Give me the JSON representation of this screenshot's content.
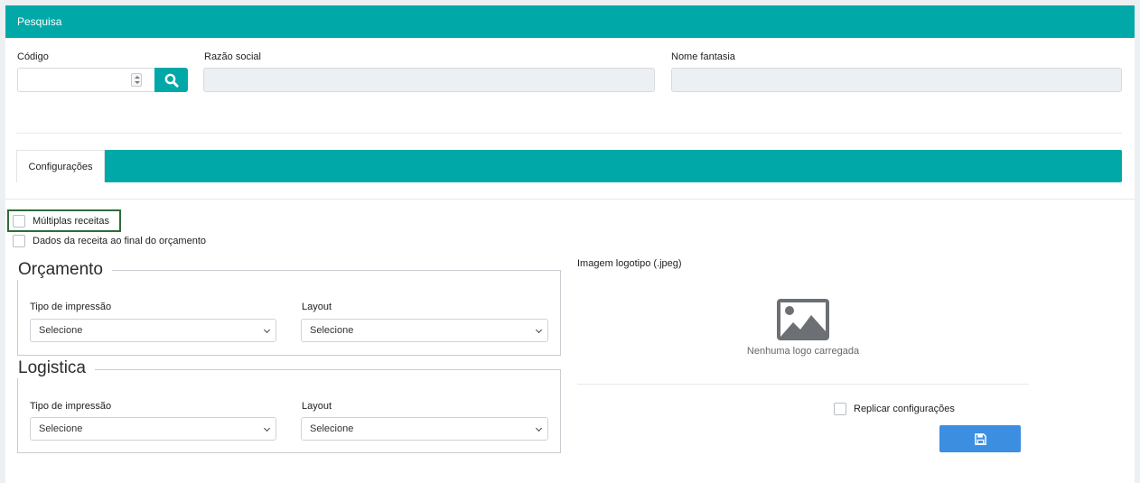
{
  "header": {
    "title": "Pesquisa"
  },
  "search": {
    "codigo_label": "Código",
    "codigo_value": "",
    "razao_label": "Razão social",
    "razao_value": "",
    "fantasia_label": "Nome fantasia",
    "fantasia_value": ""
  },
  "tabs": [
    {
      "label": "Configurações",
      "active": true
    }
  ],
  "options": {
    "multiplas_label": "Múltiplas receitas",
    "multiplas_checked": false,
    "dados_label": "Dados da receita ao final do orçamento",
    "dados_checked": false
  },
  "orcamento": {
    "title": "Orçamento",
    "tipo_label": "Tipo de impressão",
    "tipo_value": "Selecione",
    "layout_label": "Layout",
    "layout_value": "Selecione"
  },
  "logistica": {
    "title": "Logistica",
    "tipo_label": "Tipo de impressão",
    "tipo_value": "Selecione",
    "layout_label": "Layout",
    "layout_value": "Selecione"
  },
  "logo": {
    "label": "Imagem logotipo (.jpeg)",
    "empty_text": "Nenhuma logo carregada"
  },
  "replicar": {
    "label": "Replicar configurações",
    "checked": false
  },
  "colors": {
    "accent": "#00a9a7",
    "save": "#3c8fe0",
    "highlight": "#2f6b3a"
  },
  "icons": {
    "search": "search-icon",
    "save": "floppy-disk-icon",
    "image": "image-placeholder-icon"
  }
}
